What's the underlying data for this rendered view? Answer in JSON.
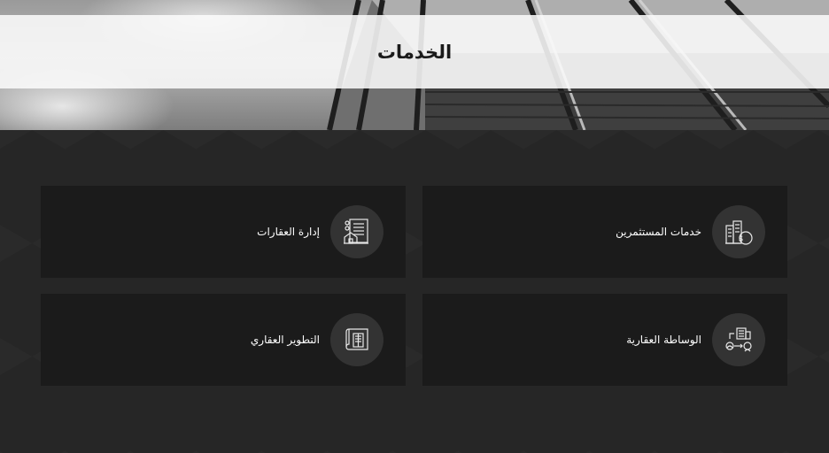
{
  "page": {
    "title": "الخدمات"
  },
  "services": [
    {
      "label": "خدمات المستثمرين",
      "icon": "investor-building-coin-icon"
    },
    {
      "label": "إدارة العقارات",
      "icon": "property-management-document-icon"
    },
    {
      "label": "الوساطة العقارية",
      "icon": "brokerage-people-building-icon"
    },
    {
      "label": "التطوير العقاري",
      "icon": "development-blueprint-icon"
    }
  ],
  "colors": {
    "background": "#262626",
    "card": "#1b1b1b",
    "icon_circle": "#333333",
    "text": "#ffffff"
  }
}
